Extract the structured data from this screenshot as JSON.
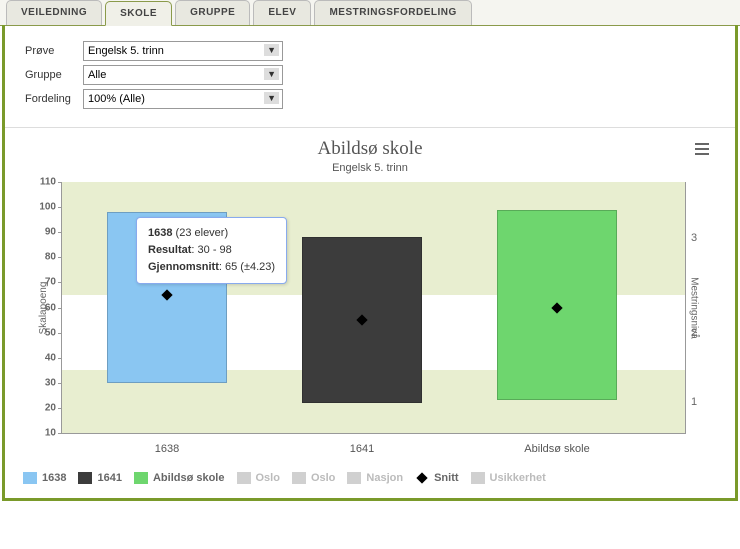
{
  "tabs": {
    "items": [
      {
        "label": "VEILEDNING",
        "active": false
      },
      {
        "label": "SKOLE",
        "active": true
      },
      {
        "label": "GRUPPE",
        "active": false
      },
      {
        "label": "ELEV",
        "active": false
      },
      {
        "label": "MESTRINGSFORDELING",
        "active": false
      }
    ]
  },
  "filters": {
    "prove_label": "Prøve",
    "prove_value": "Engelsk 5. trinn",
    "gruppe_label": "Gruppe",
    "gruppe_value": "Alle",
    "fordeling_label": "Fordeling",
    "fordeling_value": "100% (Alle)"
  },
  "chart": {
    "title": "Abildsø skole",
    "subtitle": "Engelsk 5. trinn",
    "yaxis_left_label": "Skalapoeng",
    "yaxis_right_label": "Mestringsnivå",
    "ticks_left": [
      "110",
      "100",
      "90",
      "80",
      "70",
      "60",
      "50",
      "40",
      "30",
      "20",
      "10"
    ],
    "ticks_right": [
      "1",
      "2",
      "3"
    ],
    "x_labels": [
      "1638",
      "1641",
      "Abildsø skole"
    ]
  },
  "tooltip": {
    "name": "1638",
    "count_text": "(23 elever)",
    "resultat_label": "Resultat",
    "resultat_value": "30 - 98",
    "snitt_label": "Gjennomsnitt",
    "snitt_value": "65 (±4.23)"
  },
  "legend": {
    "items": [
      {
        "label": "1638",
        "color": "#8ac6f2",
        "muted": false
      },
      {
        "label": "1641",
        "color": "#3c3c3c",
        "muted": false
      },
      {
        "label": "Abildsø skole",
        "color": "#6ed66e",
        "muted": false
      },
      {
        "label": "Oslo",
        "color": "#d0d0d0",
        "muted": true
      },
      {
        "label": "Oslo",
        "color": "#d0d0d0",
        "muted": true
      },
      {
        "label": "Nasjon",
        "color": "#d0d0d0",
        "muted": true
      }
    ],
    "snitt_label": "Snitt",
    "usikkerhet_label": "Usikkerhet",
    "usikkerhet_color": "#d0d0d0"
  },
  "chart_data": {
    "type": "bar",
    "title": "Abildsø skole",
    "subtitle": "Engelsk 5. trinn",
    "xlabel": "",
    "ylabel_left": "Skalapoeng",
    "ylabel_right": "Mestringsnivå",
    "ylim": [
      10,
      110
    ],
    "categories": [
      "1638",
      "1641",
      "Abildsø skole"
    ],
    "series": [
      {
        "name": "range",
        "low": [
          30,
          22,
          23
        ],
        "high": [
          98,
          88,
          99
        ]
      },
      {
        "name": "Snitt",
        "values": [
          65,
          55,
          60
        ]
      }
    ],
    "colors": {
      "1638": "#8ac6f2",
      "1641": "#3c3c3c",
      "Abildsø skole": "#6ed66e"
    },
    "bands": [
      {
        "from": 10,
        "to": 35,
        "label": "1"
      },
      {
        "from": 35,
        "to": 65,
        "label": "2"
      },
      {
        "from": 65,
        "to": 110,
        "label": "3"
      }
    ],
    "tooltip_sample": {
      "category": "1638",
      "count": 23,
      "result_low": 30,
      "result_high": 98,
      "mean": 65,
      "mean_err": 4.23
    }
  }
}
